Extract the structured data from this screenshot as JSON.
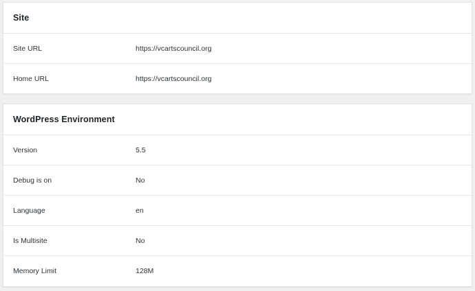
{
  "site": {
    "title": "Site",
    "rows": [
      {
        "label": "Site URL",
        "value": "https://vcartscouncil.org"
      },
      {
        "label": "Home URL",
        "value": "https://vcartscouncil.org"
      }
    ]
  },
  "wordpress_environment": {
    "title": "WordPress Environment",
    "rows": [
      {
        "label": "Version",
        "value": "5.5"
      },
      {
        "label": "Debug is on",
        "value": "No"
      },
      {
        "label": "Language",
        "value": "en"
      },
      {
        "label": "Is Multisite",
        "value": "No"
      },
      {
        "label": "Memory Limit",
        "value": "128M"
      }
    ]
  }
}
